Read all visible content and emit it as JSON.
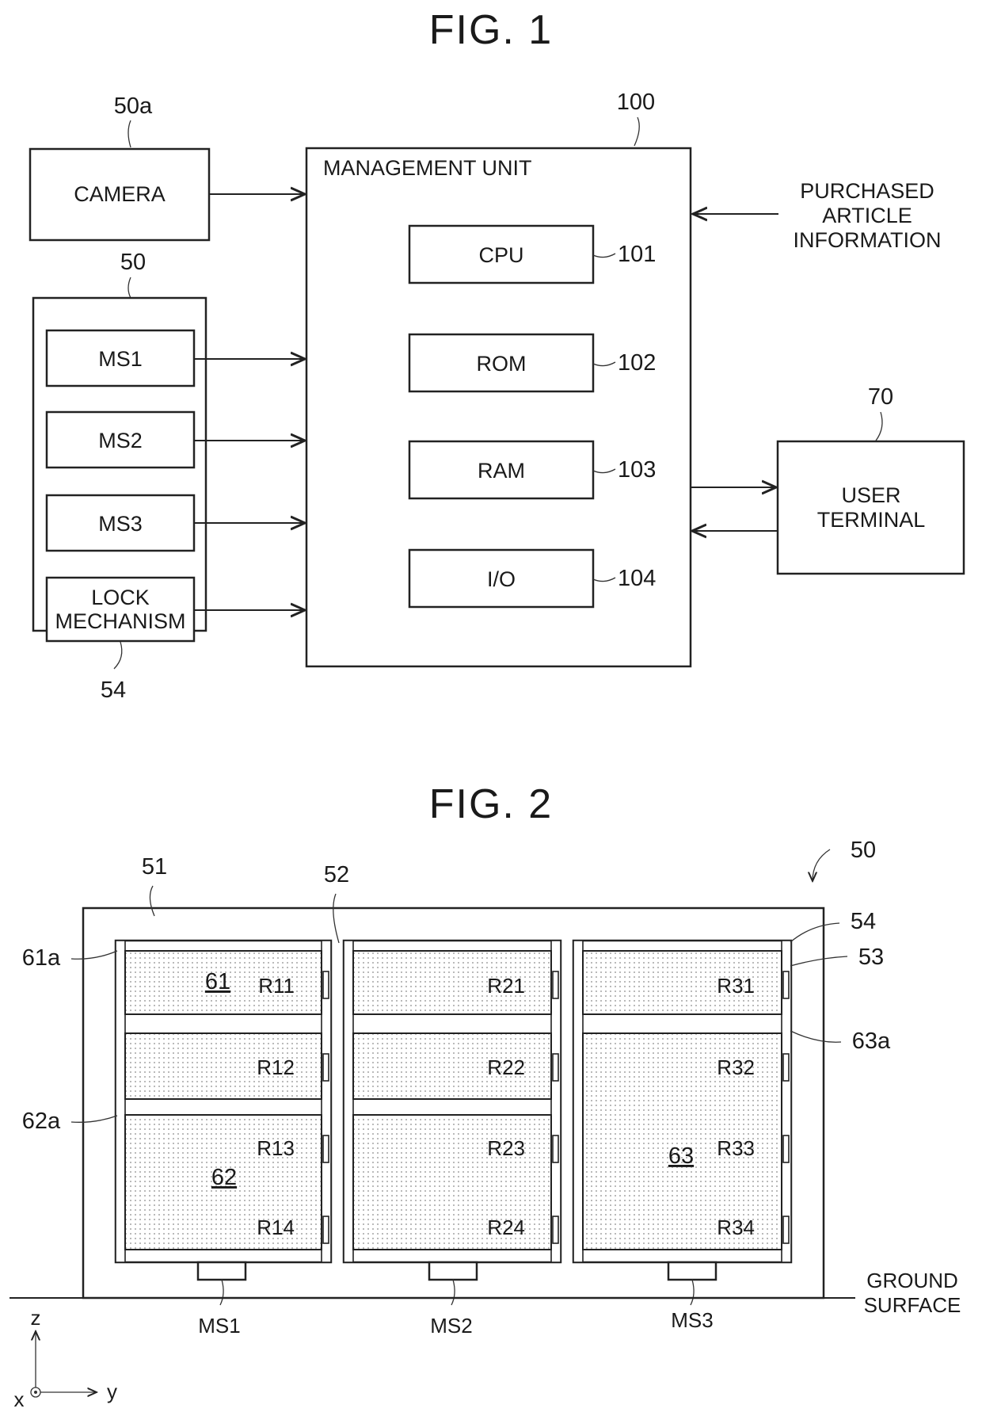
{
  "fig1": {
    "title": "FIG. 1",
    "camera": {
      "label": "CAMERA",
      "ref": "50a"
    },
    "storage_group": {
      "ref": "50"
    },
    "sensors": [
      {
        "label": "MS1"
      },
      {
        "label": "MS2"
      },
      {
        "label": "MS3"
      }
    ],
    "lock": {
      "label_line1": "LOCK",
      "label_line2": "MECHANISM",
      "ref": "54"
    },
    "management_unit": {
      "label": "MANAGEMENT UNIT",
      "ref": "100",
      "components": [
        {
          "label": "CPU",
          "ref": "101"
        },
        {
          "label": "ROM",
          "ref": "102"
        },
        {
          "label": "RAM",
          "ref": "103"
        },
        {
          "label": "I/O",
          "ref": "104"
        }
      ]
    },
    "purchased_info": {
      "line1": "PURCHASED",
      "line2": "ARTICLE",
      "line3": "INFORMATION"
    },
    "user_terminal": {
      "line1": "USER",
      "line2": "TERMINAL",
      "ref": "70"
    }
  },
  "fig2": {
    "title": "FIG. 2",
    "refs": {
      "apparatus": "50",
      "frame": "51",
      "divider": "52",
      "rail": "53",
      "lock": "54",
      "box61a": "61a",
      "box62a": "62a",
      "box63a": "63a"
    },
    "boxes": {
      "b61": "61",
      "b62": "62",
      "b63": "63"
    },
    "rfid": {
      "col1": [
        "R11",
        "R12",
        "R13",
        "R14"
      ],
      "col2": [
        "R21",
        "R22",
        "R23",
        "R24"
      ],
      "col3": [
        "R31",
        "R32",
        "R33",
        "R34"
      ]
    },
    "sensors": [
      "MS1",
      "MS2",
      "MS3"
    ],
    "ground": {
      "line1": "GROUND",
      "line2": "SURFACE"
    },
    "axes": {
      "z": "z",
      "y": "y",
      "x": "x"
    }
  }
}
